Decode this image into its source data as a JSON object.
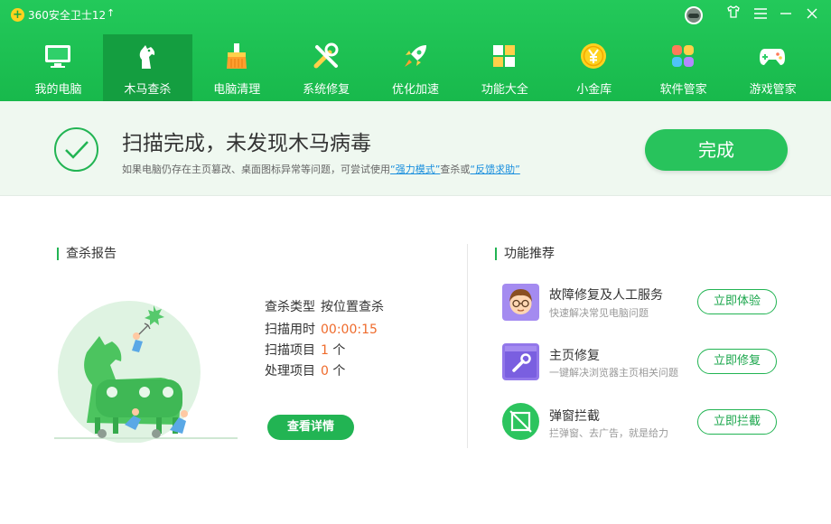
{
  "titlebar": {
    "logo": "+",
    "app_title": "360安全卫士12",
    "update_icon": "↑"
  },
  "nav": [
    {
      "label": "我的电脑",
      "icon": "monitor-icon"
    },
    {
      "label": "木马查杀",
      "icon": "horse-icon",
      "active": true
    },
    {
      "label": "电脑清理",
      "icon": "broom-icon"
    },
    {
      "label": "系统修复",
      "icon": "tools-icon"
    },
    {
      "label": "优化加速",
      "icon": "rocket-icon"
    },
    {
      "label": "功能大全",
      "icon": "grid-icon"
    },
    {
      "label": "小金库",
      "icon": "coin-icon"
    },
    {
      "label": "软件管家",
      "icon": "apps-icon"
    },
    {
      "label": "游戏管家",
      "icon": "gamepad-icon"
    }
  ],
  "status": {
    "title": "扫描完成，未发现木马病毒",
    "desc_prefix": "如果电脑仍存在主页篡改、桌面图标异常等问题，可尝试使用",
    "link1": "“强力模式”",
    "desc_mid": "查杀或",
    "link2": "“反馈求助”",
    "done_button": "完成"
  },
  "report": {
    "title": "查杀报告",
    "rows": [
      {
        "label": "查杀类型",
        "value": "按位置查杀",
        "unit": ""
      },
      {
        "label": "扫描用时",
        "value": "00:00:15",
        "unit": ""
      },
      {
        "label": "扫描项目",
        "value": "1",
        "unit": " 个"
      },
      {
        "label": "处理项目",
        "value": "0",
        "unit": " 个"
      }
    ],
    "details_button": "查看详情"
  },
  "recommend": {
    "title": "功能推荐",
    "items": [
      {
        "title": "故障修复及人工服务",
        "sub": "快速解决常见电脑问题",
        "button": "立即体验"
      },
      {
        "title": "主页修复",
        "sub": "一键解决浏览器主页相关问题",
        "button": "立即修复"
      },
      {
        "title": "弹窗拦截",
        "sub": "拦弹窗、去广告，就是给力",
        "button": "立即拦截"
      }
    ]
  },
  "colors": {
    "brand_green": "#22b453",
    "accent_orange": "#ef6b2c",
    "link_blue": "#1a8fde"
  }
}
